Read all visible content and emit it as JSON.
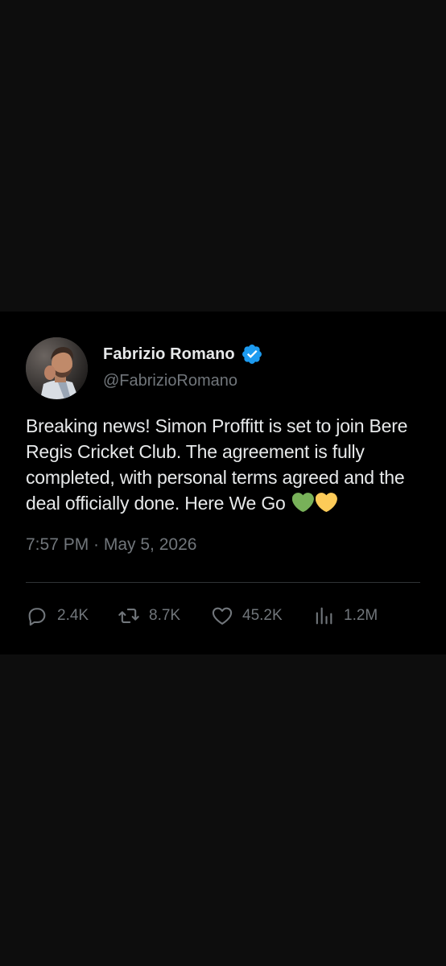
{
  "tweet": {
    "author": {
      "display_name": "Fabrizio Romano",
      "handle": "@FabrizioRomano",
      "verified_icon": "verified-badge-icon"
    },
    "text": "Breaking news! Simon Proffitt is set to join Bere Regis Cricket Club. The agreement is fully completed, with personal terms agreed and the deal officially done. Here We Go",
    "emojis": [
      "green-heart",
      "yellow-heart"
    ],
    "timestamp": "7:57 PM · May 5, 2026",
    "stats": {
      "replies": "2.4K",
      "retweets": "8.7K",
      "likes": "45.2K",
      "views": "1.2M"
    }
  },
  "colors": {
    "background": "#0d0d0d",
    "card": "#000000",
    "text_primary": "#e7e9ea",
    "text_secondary": "#71767b",
    "verified": "#1d9bf0",
    "divider": "#2f3336",
    "green_heart": "#78b159",
    "yellow_heart": "#fdcb58"
  }
}
